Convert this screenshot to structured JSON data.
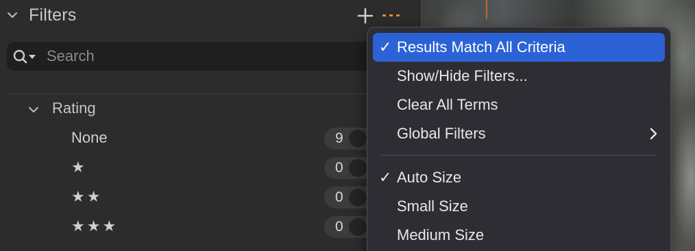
{
  "panel": {
    "title": "Filters",
    "search_placeholder": "Search",
    "rating_section": {
      "label": "Rating",
      "rows": [
        {
          "label": "None",
          "count": "9"
        },
        {
          "label": "★",
          "count": "0"
        },
        {
          "label": "★★",
          "count": "0"
        },
        {
          "label": "★★★",
          "count": "0"
        }
      ]
    }
  },
  "menu": {
    "groups": [
      [
        {
          "label": "Results Match All Criteria",
          "checked": true,
          "selected": true,
          "submenu": false
        },
        {
          "label": "Show/Hide Filters...",
          "checked": false,
          "selected": false,
          "submenu": false
        },
        {
          "label": "Clear All Terms",
          "checked": false,
          "selected": false,
          "submenu": false
        },
        {
          "label": "Global Filters",
          "checked": false,
          "selected": false,
          "submenu": true
        }
      ],
      [
        {
          "label": "Auto Size",
          "checked": true,
          "selected": false,
          "submenu": false
        },
        {
          "label": "Small Size",
          "checked": false,
          "selected": false,
          "submenu": false
        },
        {
          "label": "Medium Size",
          "checked": false,
          "selected": false,
          "submenu": false
        }
      ]
    ],
    "check_glyph": "✓"
  },
  "icons": {
    "header_chevron": "chevron-down-icon",
    "add": "plus-icon",
    "more": "more-horizontal-icon",
    "search": "search-icon",
    "submenu": "chevron-right-icon"
  },
  "colors": {
    "accent_orange": "#e8892c",
    "menu_highlight": "#2b63d6"
  }
}
